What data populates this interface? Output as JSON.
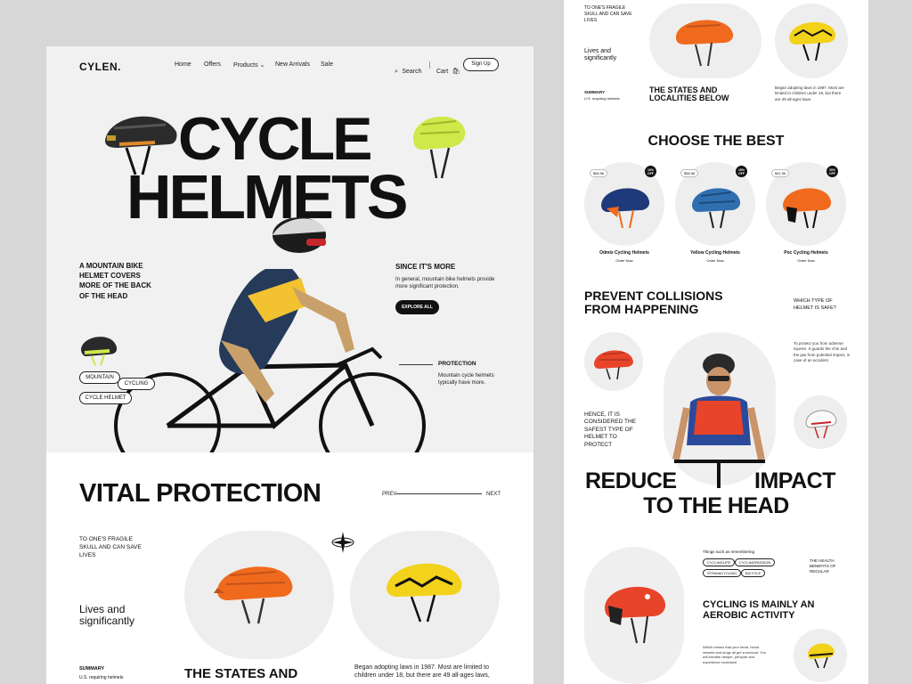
{
  "header": {
    "logo": "CYLEN.",
    "nav": [
      "Home",
      "Offers",
      "Products",
      "New Arrivals",
      "Sale"
    ],
    "search": "Search",
    "cart": "Cart",
    "signup": "Sign Up"
  },
  "hero": {
    "title_line1": "CYCLE",
    "title_line2": "HELMETS",
    "left_text": "A MOUNTAIN BIKE HELMET COVERS MORE OF THE BACK OF THE HEAD",
    "since_title": "SINCE IT'S MORE",
    "since_body": "In general, mountain bike helmets provide more significant protection.",
    "explore": "EXPLORE ALL",
    "protection_title": "PROTECTION",
    "protection_body": "Mountain cycle helmets typically have more.",
    "tags": [
      "MOUNTAIN",
      "CYCLING",
      "CYCLE HELMET"
    ]
  },
  "vital": {
    "title": "VITAL PROTECTION",
    "prev": "PREV",
    "next": "NEXT",
    "fragile": "TO ONE'S FRAGILE SKULL AND CAN SAVE LIVES",
    "lives": "Lives and significantly",
    "summary_title": "SUMMARY",
    "summary_body": "U.S. requiring helmets",
    "states": "THE STATES AND",
    "laws": "Began adopting laws in 1987. Most are limited to children under 18, but there are 49 all-ages laws,"
  },
  "right": {
    "fragile": "TO ONE'S FRAGILE SKULL AND CAN SAVE LIVES",
    "lives": "Lives and significantly",
    "summary_title": "SUMMARY",
    "summary_body": "U.S. requiring helmets",
    "states": "THE STATES AND LOCALITIES BELOW",
    "laws": "Began adopting laws in 1987. Most are limited to children under 18, but there are 49 all-ages laws.",
    "choose": "CHOOSE THE BEST",
    "products": [
      {
        "price": "$56.56",
        "badge": "10% OFF",
        "name": "Odmix Cycling Helmets",
        "cta": "Order Now",
        "color": "#1f3a7a"
      },
      {
        "price": "$56.56",
        "badge": "15% OFF",
        "name": "Yellow Cycling Helmets",
        "cta": "Order Now",
        "color": "#2f6fb0"
      },
      {
        "price": "$41.56",
        "badge": "20% OFF",
        "name": "Poc Cycling Helmets",
        "cta": "Order Now",
        "color": "#f06a1e"
      }
    ],
    "prevent": "PREVENT COLLISIONS FROM HAPPENING",
    "which": "WHICH TYPE OF HELMET IS SAFE?",
    "protect_body": "To protect you from adverse injuries. It guards the chin and the jaw from potential impact, in case of an accident.",
    "hence": "HENCE, IT IS CONSIDERED THE SAFEST TYPE OF HELMET TO PROTECT",
    "reduce_l1a": "REDUCE",
    "reduce_l1b": "IMPACT",
    "reduce_l2": "TO THE HEAD",
    "things": "Things such as remembering",
    "hashtags": [
      "CYCLINGLIFE",
      "CYCLINGPASSION",
      "STRAVACYCLING",
      "BICYCLE"
    ],
    "health": "THE HEALTH BENEFITS OF REGULAR",
    "aerobic": "CYCLING IS MAINLY AN AEROBIC ACTIVITY",
    "aerobic_body": "Which means that your heart, blood vessels and lungs all get a workout. You will breathe deeper, perspire and experience increased"
  },
  "colors": {
    "orange": "#f06a1e",
    "yellow": "#f2d21b",
    "lime": "#cfe84a",
    "navy": "#1f3a7a",
    "red": "#e8442a"
  }
}
